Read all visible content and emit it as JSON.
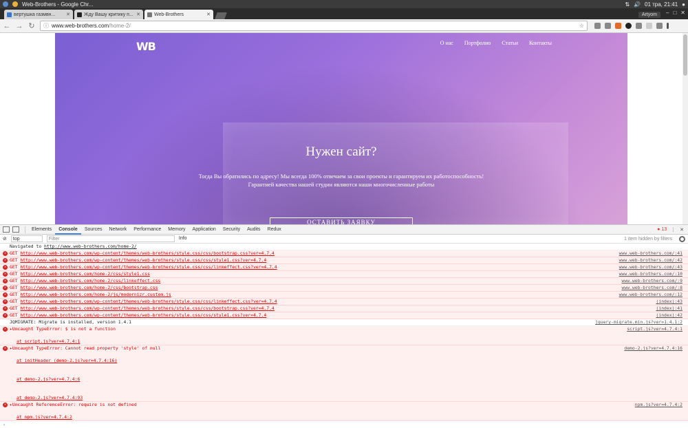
{
  "system": {
    "window_title": "Web-Brothers - Google Chr...",
    "clock": "01 тра, 21:41"
  },
  "browser": {
    "tabs": [
      {
        "label": "вертушка газмвн..."
      },
      {
        "label": "Жду Вашу критику п..."
      },
      {
        "label": "Web-Brothers"
      }
    ],
    "profile": "Artyom",
    "url_host": "www.web-brothers.com",
    "url_path": "/home-2/"
  },
  "site": {
    "logo": "WB",
    "nav": [
      "О нас",
      "Портфолио",
      "Статьи",
      "Контакты"
    ],
    "hero_title": "Нужен сайт?",
    "hero_line1": "Тогда Вы обратились по адресу! Мы всегда 100% отвечаем за свои проекты и гарантируем их работоспособность!",
    "hero_line2": "Гарантией качества нашей студии являются наши многочисленные работы",
    "cta": "ОСТАВИТЬ ЗАЯВКУ"
  },
  "devtools": {
    "tabs": [
      "Elements",
      "Console",
      "Sources",
      "Network",
      "Performance",
      "Memory",
      "Application",
      "Security",
      "Audits",
      "Redux"
    ],
    "error_count": "13",
    "context": "top",
    "filter_placeholder": "Filter",
    "level": "Info",
    "hidden_note": "1 item hidden by filters"
  },
  "console": {
    "navigated": {
      "text": "Navigated to",
      "url": "http://www.web-brothers.com/home-2/"
    },
    "gets": [
      {
        "url": "http://www.web-brothers.com/wp-content/themes/web-brothers/style.css/css/bootstrap.css?ver=4.7.4",
        "src": "www.web-brothers.com/:41"
      },
      {
        "url": "http://www.web-brothers.com/wp-content/themes/web-brothers/style.css/css/style1.css?ver=4.7.4",
        "src": "www.web-brothers.com/:42"
      },
      {
        "url": "http://www.web-brothers.com/wp-content/themes/web-brothers/style.css/css/linkeffect.css?ver=4.7.4",
        "src": "www.web-brothers.com/:43"
      },
      {
        "url": "http://www.web-brothers.com/home-2/css/style1.css",
        "src": "www.web-brothers.com/:10"
      },
      {
        "url": "http://www.web-brothers.com/home-2/css/linkeffect.css",
        "src": "www.web-brothers.com/:9"
      },
      {
        "url": "http://www.web-brothers.com/home-2/css/bootstrap.css",
        "src": "www.web-brothers.com/:8"
      },
      {
        "url": "http://www.web-brothers.com/home-2/js/modernizr.custom.js",
        "src": "www.web-brothers.com/:12"
      },
      {
        "url": "http://www.web-brothers.com/wp-content/themes/web-brothers/style.css/css/linkeffect.css?ver=4.7.4",
        "src": "(index):43"
      },
      {
        "url": "http://www.web-brothers.com/wp-content/themes/web-brothers/style.css/css/bootstrap.css?ver=4.7.4",
        "src": "(index):41"
      },
      {
        "url": "http://www.web-brothers.com/wp-content/themes/web-brothers/style.css/css/style1.css?ver=4.7.4",
        "src": "(index):42"
      }
    ],
    "get_label": "GET",
    "jqmigrate": {
      "text": "JQMIGRATE: Migrate is installed, version 1.4.1",
      "src": "jquery-migrate.min.js?ver=1.4.1:2"
    },
    "err1": {
      "text": "Uncaught TypeError: $ is not a function",
      "at1": "at script.js?ver=4.7.4:1",
      "src": "script.js?ver=4.7.4:1"
    },
    "err2": {
      "text": "Uncaught TypeError: Cannot read property 'style' of null",
      "at1": "at initHeader (demo-2.js?ver=4.7.4:16)",
      "at2": "at demo-2.js?ver=4.7.4:6",
      "at3": "at demo-2.js?ver=4.7.4:93",
      "src": "demo-2.js?ver=4.7.4:16"
    },
    "err3": {
      "text": "Uncaught ReferenceError: require is not defined",
      "at1": "at npm.js?ver=4.7.4:2",
      "src": "npm.js?ver=4.7.4:2"
    },
    "prompt": "›"
  }
}
